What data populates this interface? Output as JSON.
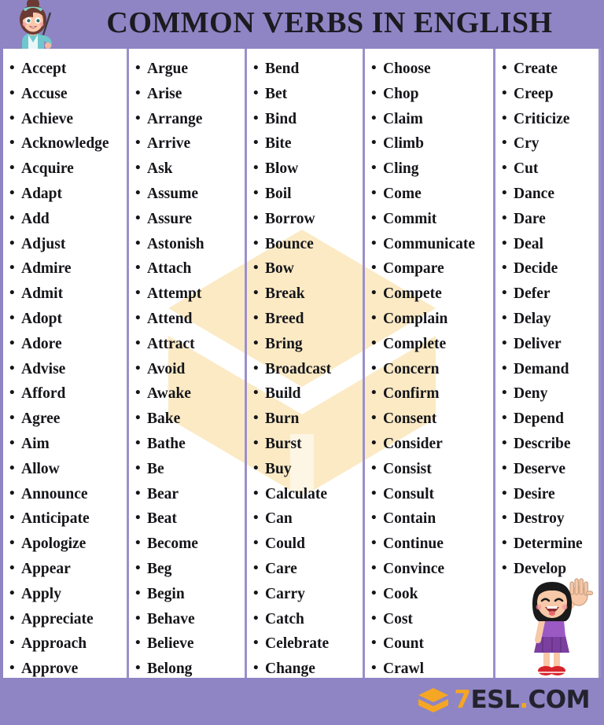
{
  "header": {
    "title": "COMMON VERBS IN ENGLISH",
    "teacher_icon": "teacher-with-pointer-illustration"
  },
  "theme": {
    "header_bg": "#8f84c4",
    "divider": "#9a90cb",
    "page_bg": "#ffffff",
    "text": "#15151a",
    "watermark": "#fbeac4",
    "logo_accent": "#f5a623",
    "logo_text": "#23232e"
  },
  "watermark": {
    "icon": "graduation-cap-hexagon-watermark"
  },
  "girl": {
    "icon": "waving-girl-illustration"
  },
  "footer": {
    "logo": {
      "cap_icon": "graduation-cap-icon",
      "seven": "7",
      "name": "ESL",
      "dot": ".",
      "tld": "COM"
    }
  },
  "columns": [
    {
      "id": "column-1",
      "items": [
        "Accept",
        "Accuse",
        "Achieve",
        "Acknowledge",
        "Acquire",
        "Adapt",
        "Add",
        "Adjust",
        "Admire",
        "Admit",
        "Adopt",
        "Adore",
        "Advise",
        "Afford",
        "Agree",
        "Aim",
        "Allow",
        "Announce",
        "Anticipate",
        "Apologize",
        "Appear",
        "Apply",
        "Appreciate",
        "Approach",
        "Approve"
      ]
    },
    {
      "id": "column-2",
      "items": [
        "Argue",
        "Arise",
        "Arrange",
        "Arrive",
        "Ask",
        "Assume",
        "Assure",
        "Astonish",
        "Attach",
        "Attempt",
        "Attend",
        "Attract",
        "Avoid",
        "Awake",
        "Bake",
        "Bathe",
        "Be",
        "Bear",
        "Beat",
        "Become",
        "Beg",
        "Begin",
        "Behave",
        "Believe",
        "Belong"
      ]
    },
    {
      "id": "column-3",
      "items": [
        "Bend",
        "Bet",
        "Bind",
        "Bite",
        "Blow",
        "Boil",
        "Borrow",
        "Bounce",
        "Bow",
        "Break",
        "Breed",
        "Bring",
        "Broadcast",
        "Build",
        "Burn",
        "Burst",
        "Buy",
        "Calculate",
        "Can",
        "Could",
        "Care",
        "Carry",
        "Catch",
        "Celebrate",
        "Change"
      ]
    },
    {
      "id": "column-4",
      "items": [
        "Choose",
        "Chop",
        "Claim",
        "Climb",
        "Cling",
        "Come",
        "Commit",
        "Communicate",
        "Compare",
        "Compete",
        "Complain",
        "Complete",
        "Concern",
        "Confirm",
        "Consent",
        "Consider",
        "Consist",
        "Consult",
        "Contain",
        "Continue",
        "Convince",
        "Cook",
        "Cost",
        "Count",
        "Crawl"
      ]
    },
    {
      "id": "column-5",
      "items": [
        "Create",
        "Creep",
        "Criticize",
        "Cry",
        "Cut",
        "Dance",
        "Dare",
        "Deal",
        "Decide",
        "Defer",
        "Delay",
        "Deliver",
        "Demand",
        "Deny",
        "Depend",
        "Describe",
        "Deserve",
        "Desire",
        "Destroy",
        "Determine",
        "Develop"
      ]
    }
  ]
}
